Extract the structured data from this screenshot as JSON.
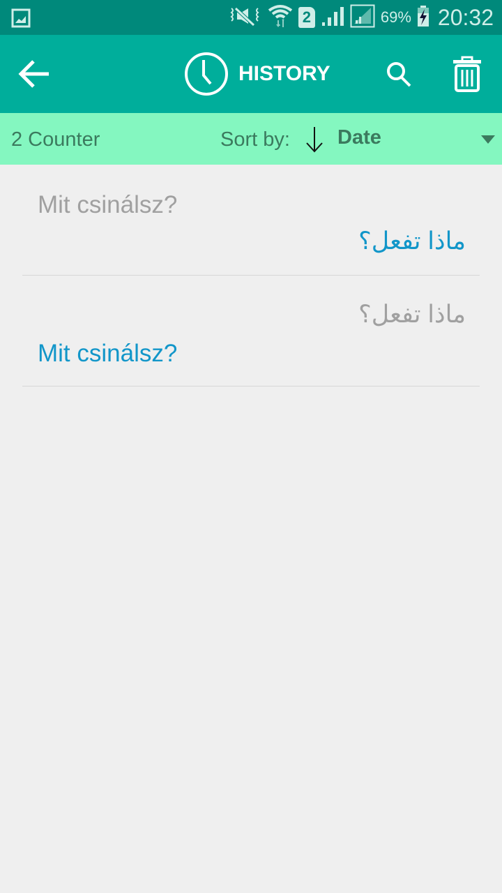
{
  "status_bar": {
    "icons": [
      "gallery-icon",
      "vibrate-mute-icon",
      "wifi-icon",
      "sim-icon",
      "signal-icon",
      "signal-outline-icon",
      "battery-charging-icon"
    ],
    "sim_number": "2",
    "battery_percent": "69%",
    "time": "20:32"
  },
  "app_bar": {
    "title": "HISTORY",
    "back_icon": "arrow-left-icon",
    "title_icon": "clock-icon",
    "search_icon": "search-icon",
    "delete_icon": "trash-icon",
    "background": "#00ae9b"
  },
  "sort_bar": {
    "counter": "2 Counter",
    "sort_label": "Sort by:",
    "sort_direction_icon": "arrow-down-icon",
    "sort_value": "Date",
    "background": "#84f7c0"
  },
  "history": [
    {
      "source": "Mit csinálsz?",
      "source_dir": "ltr",
      "translation": "ماذا تفعل؟",
      "translation_dir": "rtl"
    },
    {
      "source": "ماذا تفعل؟",
      "source_dir": "rtl",
      "translation": "Mit csinálsz?",
      "translation_dir": "ltr"
    }
  ],
  "colors": {
    "status_bar": "#00897b",
    "source_text": "#a0a0a0",
    "translation_text": "#1296c9"
  }
}
